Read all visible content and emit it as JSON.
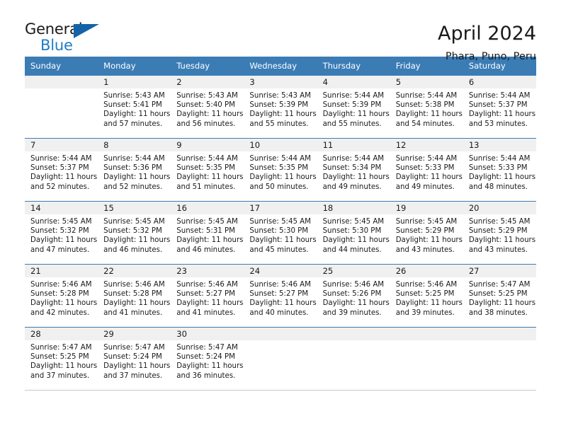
{
  "brand": {
    "name_part1": "General",
    "name_part2": "Blue",
    "triangle_color": "#1463a8",
    "blue_color": "#1f7dc4"
  },
  "header": {
    "title": "April 2024",
    "subtitle": "Phara, Puno, Peru",
    "header_bg": "#3b7cb5",
    "header_text_color": "#ffffff"
  },
  "weekdays": [
    "Sunday",
    "Monday",
    "Tuesday",
    "Wednesday",
    "Thursday",
    "Friday",
    "Saturday"
  ],
  "labels": {
    "sunrise": "Sunrise:",
    "sunset": "Sunset:",
    "daylight": "Daylight:"
  },
  "weeks": [
    [
      {
        "day": "",
        "sunrise": "",
        "sunset": "",
        "daylight_line1": "",
        "daylight_line2": ""
      },
      {
        "day": "1",
        "sunrise": "Sunrise: 5:43 AM",
        "sunset": "Sunset: 5:41 PM",
        "daylight_line1": "Daylight: 11 hours",
        "daylight_line2": "and 57 minutes."
      },
      {
        "day": "2",
        "sunrise": "Sunrise: 5:43 AM",
        "sunset": "Sunset: 5:40 PM",
        "daylight_line1": "Daylight: 11 hours",
        "daylight_line2": "and 56 minutes."
      },
      {
        "day": "3",
        "sunrise": "Sunrise: 5:43 AM",
        "sunset": "Sunset: 5:39 PM",
        "daylight_line1": "Daylight: 11 hours",
        "daylight_line2": "and 55 minutes."
      },
      {
        "day": "4",
        "sunrise": "Sunrise: 5:44 AM",
        "sunset": "Sunset: 5:39 PM",
        "daylight_line1": "Daylight: 11 hours",
        "daylight_line2": "and 55 minutes."
      },
      {
        "day": "5",
        "sunrise": "Sunrise: 5:44 AM",
        "sunset": "Sunset: 5:38 PM",
        "daylight_line1": "Daylight: 11 hours",
        "daylight_line2": "and 54 minutes."
      },
      {
        "day": "6",
        "sunrise": "Sunrise: 5:44 AM",
        "sunset": "Sunset: 5:37 PM",
        "daylight_line1": "Daylight: 11 hours",
        "daylight_line2": "and 53 minutes."
      }
    ],
    [
      {
        "day": "7",
        "sunrise": "Sunrise: 5:44 AM",
        "sunset": "Sunset: 5:37 PM",
        "daylight_line1": "Daylight: 11 hours",
        "daylight_line2": "and 52 minutes."
      },
      {
        "day": "8",
        "sunrise": "Sunrise: 5:44 AM",
        "sunset": "Sunset: 5:36 PM",
        "daylight_line1": "Daylight: 11 hours",
        "daylight_line2": "and 52 minutes."
      },
      {
        "day": "9",
        "sunrise": "Sunrise: 5:44 AM",
        "sunset": "Sunset: 5:35 PM",
        "daylight_line1": "Daylight: 11 hours",
        "daylight_line2": "and 51 minutes."
      },
      {
        "day": "10",
        "sunrise": "Sunrise: 5:44 AM",
        "sunset": "Sunset: 5:35 PM",
        "daylight_line1": "Daylight: 11 hours",
        "daylight_line2": "and 50 minutes."
      },
      {
        "day": "11",
        "sunrise": "Sunrise: 5:44 AM",
        "sunset": "Sunset: 5:34 PM",
        "daylight_line1": "Daylight: 11 hours",
        "daylight_line2": "and 49 minutes."
      },
      {
        "day": "12",
        "sunrise": "Sunrise: 5:44 AM",
        "sunset": "Sunset: 5:33 PM",
        "daylight_line1": "Daylight: 11 hours",
        "daylight_line2": "and 49 minutes."
      },
      {
        "day": "13",
        "sunrise": "Sunrise: 5:44 AM",
        "sunset": "Sunset: 5:33 PM",
        "daylight_line1": "Daylight: 11 hours",
        "daylight_line2": "and 48 minutes."
      }
    ],
    [
      {
        "day": "14",
        "sunrise": "Sunrise: 5:45 AM",
        "sunset": "Sunset: 5:32 PM",
        "daylight_line1": "Daylight: 11 hours",
        "daylight_line2": "and 47 minutes."
      },
      {
        "day": "15",
        "sunrise": "Sunrise: 5:45 AM",
        "sunset": "Sunset: 5:32 PM",
        "daylight_line1": "Daylight: 11 hours",
        "daylight_line2": "and 46 minutes."
      },
      {
        "day": "16",
        "sunrise": "Sunrise: 5:45 AM",
        "sunset": "Sunset: 5:31 PM",
        "daylight_line1": "Daylight: 11 hours",
        "daylight_line2": "and 46 minutes."
      },
      {
        "day": "17",
        "sunrise": "Sunrise: 5:45 AM",
        "sunset": "Sunset: 5:30 PM",
        "daylight_line1": "Daylight: 11 hours",
        "daylight_line2": "and 45 minutes."
      },
      {
        "day": "18",
        "sunrise": "Sunrise: 5:45 AM",
        "sunset": "Sunset: 5:30 PM",
        "daylight_line1": "Daylight: 11 hours",
        "daylight_line2": "and 44 minutes."
      },
      {
        "day": "19",
        "sunrise": "Sunrise: 5:45 AM",
        "sunset": "Sunset: 5:29 PM",
        "daylight_line1": "Daylight: 11 hours",
        "daylight_line2": "and 43 minutes."
      },
      {
        "day": "20",
        "sunrise": "Sunrise: 5:45 AM",
        "sunset": "Sunset: 5:29 PM",
        "daylight_line1": "Daylight: 11 hours",
        "daylight_line2": "and 43 minutes."
      }
    ],
    [
      {
        "day": "21",
        "sunrise": "Sunrise: 5:46 AM",
        "sunset": "Sunset: 5:28 PM",
        "daylight_line1": "Daylight: 11 hours",
        "daylight_line2": "and 42 minutes."
      },
      {
        "day": "22",
        "sunrise": "Sunrise: 5:46 AM",
        "sunset": "Sunset: 5:28 PM",
        "daylight_line1": "Daylight: 11 hours",
        "daylight_line2": "and 41 minutes."
      },
      {
        "day": "23",
        "sunrise": "Sunrise: 5:46 AM",
        "sunset": "Sunset: 5:27 PM",
        "daylight_line1": "Daylight: 11 hours",
        "daylight_line2": "and 41 minutes."
      },
      {
        "day": "24",
        "sunrise": "Sunrise: 5:46 AM",
        "sunset": "Sunset: 5:27 PM",
        "daylight_line1": "Daylight: 11 hours",
        "daylight_line2": "and 40 minutes."
      },
      {
        "day": "25",
        "sunrise": "Sunrise: 5:46 AM",
        "sunset": "Sunset: 5:26 PM",
        "daylight_line1": "Daylight: 11 hours",
        "daylight_line2": "and 39 minutes."
      },
      {
        "day": "26",
        "sunrise": "Sunrise: 5:46 AM",
        "sunset": "Sunset: 5:25 PM",
        "daylight_line1": "Daylight: 11 hours",
        "daylight_line2": "and 39 minutes."
      },
      {
        "day": "27",
        "sunrise": "Sunrise: 5:47 AM",
        "sunset": "Sunset: 5:25 PM",
        "daylight_line1": "Daylight: 11 hours",
        "daylight_line2": "and 38 minutes."
      }
    ],
    [
      {
        "day": "28",
        "sunrise": "Sunrise: 5:47 AM",
        "sunset": "Sunset: 5:25 PM",
        "daylight_line1": "Daylight: 11 hours",
        "daylight_line2": "and 37 minutes."
      },
      {
        "day": "29",
        "sunrise": "Sunrise: 5:47 AM",
        "sunset": "Sunset: 5:24 PM",
        "daylight_line1": "Daylight: 11 hours",
        "daylight_line2": "and 37 minutes."
      },
      {
        "day": "30",
        "sunrise": "Sunrise: 5:47 AM",
        "sunset": "Sunset: 5:24 PM",
        "daylight_line1": "Daylight: 11 hours",
        "daylight_line2": "and 36 minutes."
      },
      {
        "day": "",
        "sunrise": "",
        "sunset": "",
        "daylight_line1": "",
        "daylight_line2": ""
      },
      {
        "day": "",
        "sunrise": "",
        "sunset": "",
        "daylight_line1": "",
        "daylight_line2": ""
      },
      {
        "day": "",
        "sunrise": "",
        "sunset": "",
        "daylight_line1": "",
        "daylight_line2": ""
      },
      {
        "day": "",
        "sunrise": "",
        "sunset": "",
        "daylight_line1": "",
        "daylight_line2": ""
      }
    ]
  ]
}
